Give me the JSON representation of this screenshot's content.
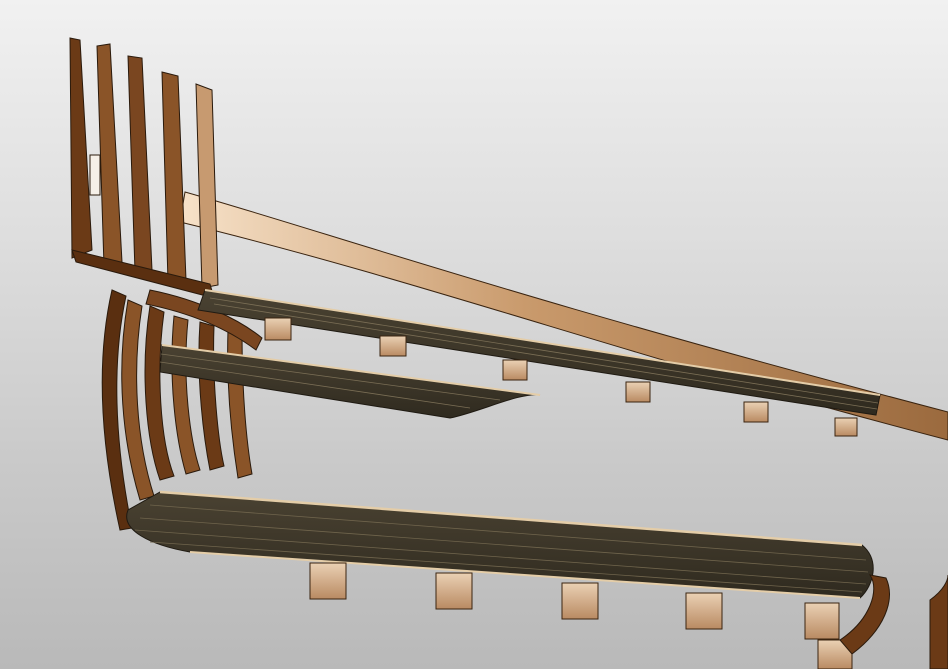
{
  "scene": {
    "colors": {
      "background_top": "#f1f1f1",
      "background_bottom": "#b9b9b9",
      "frame_dark": "#5a2f10",
      "frame_mid": "#8a5428",
      "frame_light": "#d7b08a",
      "deck_dark": "#3e3729",
      "deck_plank_line": "#7a6e55",
      "deck_edge": "#e4cda8",
      "beam_light": "#e2c09c",
      "beam_dark": "#9d7452",
      "outline": "#2a1a0c"
    }
  }
}
